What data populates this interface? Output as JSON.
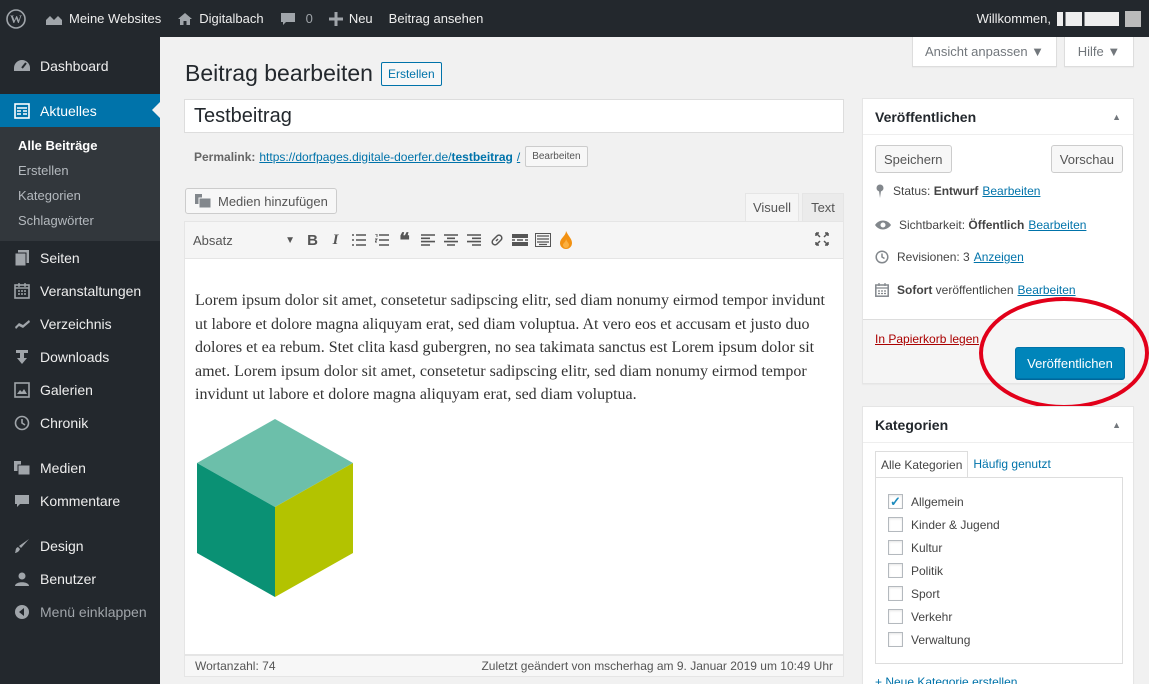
{
  "adminbar": {
    "sites": "Meine Websites",
    "site_name": "Digitalbach",
    "comments": "0",
    "new": "Neu",
    "view_post": "Beitrag ansehen",
    "greeting": "Willkommen,"
  },
  "sidebar": {
    "dashboard": "Dashboard",
    "aktuelles": "Aktuelles",
    "submenu": [
      "Alle Beiträge",
      "Erstellen",
      "Kategorien",
      "Schlagwörter"
    ],
    "seiten": "Seiten",
    "veranstaltungen": "Veranstaltungen",
    "verzeichnis": "Verzeichnis",
    "downloads": "Downloads",
    "galerien": "Galerien",
    "chronik": "Chronik",
    "medien": "Medien",
    "kommentare": "Kommentare",
    "design": "Design",
    "benutzer": "Benutzer",
    "collapse": "Menü einklappen"
  },
  "screen_meta": {
    "options": "Ansicht anpassen ▼",
    "help": "Hilfe ▼"
  },
  "page": {
    "title": "Beitrag bearbeiten",
    "add_new": "Erstellen"
  },
  "post": {
    "title": "Testbeitrag",
    "permalink_label": "Permalink:",
    "permalink_base": "https://dorfpages.digitale-doerfer.de/",
    "permalink_slug": "testbeitrag",
    "permalink_end": "/",
    "permalink_edit": "Bearbeiten"
  },
  "editor": {
    "add_media": "Medien hinzufügen",
    "tab_visual": "Visuell",
    "tab_text": "Text",
    "format": "Absatz",
    "content": "Lorem ipsum dolor sit amet, consetetur sadipscing elitr, sed diam nonumy eirmod tempor invidunt ut labore et dolore magna aliquyam erat, sed diam voluptua. At vero eos et accusam et justo duo dolores et ea rebum. Stet clita kasd gubergren, no sea takimata sanctus est Lorem ipsum dolor sit amet. Lorem ipsum dolor sit amet, consetetur sadipscing elitr, sed diam nonumy eirmod tempor invidunt ut labore et dolore magna aliquyam erat, sed diam voluptua.",
    "word_count": "Wortanzahl: 74",
    "last_edited": "Zuletzt geändert von mscherhag am 9. Januar 2019 um 10:49 Uhr"
  },
  "publish": {
    "title": "Veröffentlichen",
    "save": "Speichern",
    "preview": "Vorschau",
    "status_label": "Status:",
    "status_value": "Entwurf",
    "visibility_label": "Sichtbarkeit:",
    "visibility_value": "Öffentlich",
    "revisions": "Revisionen: 3",
    "revisions_link": "Anzeigen",
    "schedule_bold": "Sofort",
    "schedule_rest": "veröffentlichen",
    "edit": "Bearbeiten",
    "trash": "In Papierkorb legen",
    "publish_button": "Veröffentlichen"
  },
  "categories": {
    "title": "Kategorien",
    "tab_all": "Alle Kategorien",
    "tab_popular": "Häufig genutzt",
    "items": [
      {
        "label": "Allgemein",
        "checked": true
      },
      {
        "label": "Kinder & Jugend",
        "checked": false
      },
      {
        "label": "Kultur",
        "checked": false
      },
      {
        "label": "Politik",
        "checked": false
      },
      {
        "label": "Sport",
        "checked": false
      },
      {
        "label": "Verkehr",
        "checked": false
      },
      {
        "label": "Verwaltung",
        "checked": false
      }
    ],
    "add_new": "+ Neue Kategorie erstellen"
  },
  "colors": {
    "adminbar": "#23282d",
    "accent": "#0073aa",
    "publish_button": "#0085ba",
    "annotation": "#e2001a",
    "cube_top": "#6cbfaa",
    "cube_left": "#0a9174",
    "cube_right": "#b3c300"
  }
}
